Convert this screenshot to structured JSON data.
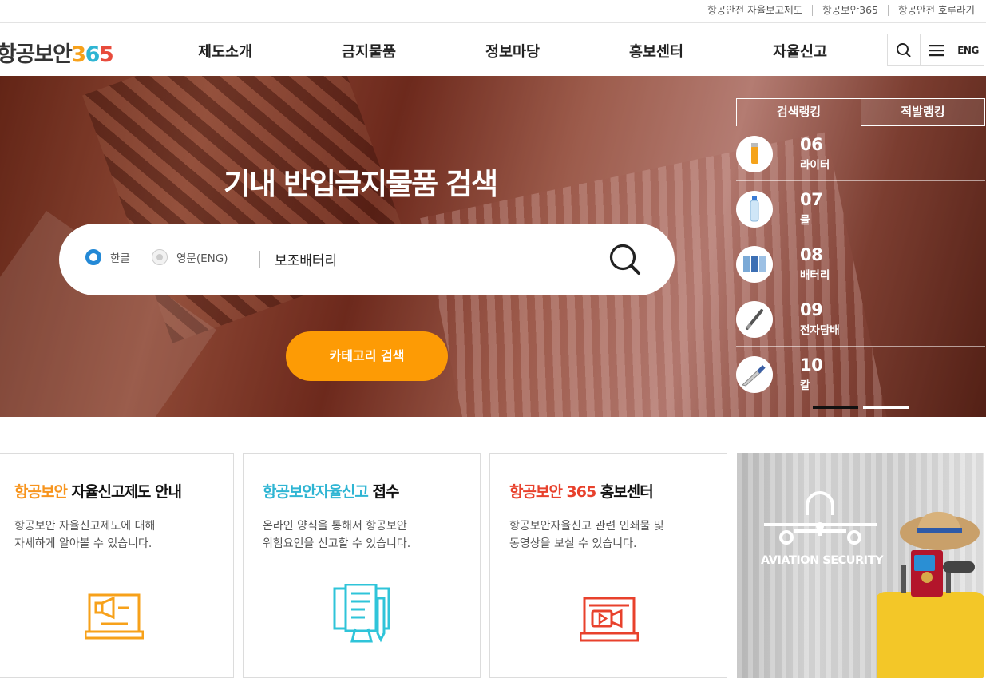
{
  "util_links": [
    "항공안전 자율보고제도",
    "항공보안365",
    "항공안전 호루라기"
  ],
  "logo": {
    "text": "항공보안",
    "d3": "3",
    "d6": "6",
    "d5": "5"
  },
  "nav": [
    "제도소개",
    "금지물품",
    "정보마당",
    "홍보센터",
    "자율신고"
  ],
  "header_buttons": {
    "search_icon": "search-icon",
    "menu_icon": "menu-icon",
    "eng_label": "ENG"
  },
  "hero": {
    "title": "기내 반입금지물품 검색",
    "radio_korean": "한글",
    "radio_english": "영문(ENG)",
    "search_value": "보조배터리",
    "category_button": "카테고리 검색"
  },
  "ranking": {
    "tabs": [
      "검색랭킹",
      "적발랭킹"
    ],
    "active_tab": 0,
    "items": [
      {
        "rank": "06",
        "name": "라이터",
        "icon": "lighter-icon"
      },
      {
        "rank": "07",
        "name": "물",
        "icon": "water-bottle-icon"
      },
      {
        "rank": "08",
        "name": "배터리",
        "icon": "battery-icon"
      },
      {
        "rank": "09",
        "name": "전자담배",
        "icon": "e-cigarette-icon"
      },
      {
        "rank": "10",
        "name": "칼",
        "icon": "knife-icon"
      }
    ],
    "pager_active": 0
  },
  "cards": [
    {
      "title_accent": "항공보안",
      "title_rest": " 자율신고제도 안내",
      "accent_color": "#f7941d",
      "desc": "항공보안 자율신고제도에 대해\n자세하게 알아볼 수 있습니다.",
      "icon": "megaphone-laptop-icon"
    },
    {
      "title_accent": "항공보안자율신고",
      "title_rest": " 접수",
      "accent_color": "#2fb5d3",
      "desc": "온라인 양식을 통해서 항공보안\n위험요인을 신고할 수 있습니다.",
      "icon": "report-form-icon"
    },
    {
      "title_accent": "항공보안 365",
      "title_rest": " 홍보센터",
      "accent_color": "#e8412c",
      "desc": "항공보안자율신고 관련 인쇄물 및\n동영상을 보실 수 있습니다.",
      "icon": "video-monitor-icon"
    }
  ],
  "promo": {
    "text": "AVIATION SECURITY",
    "icon": "airplane-lock-icon"
  },
  "colors": {
    "accent_orange": "#fd9b05",
    "radio_blue": "#2489d6"
  }
}
